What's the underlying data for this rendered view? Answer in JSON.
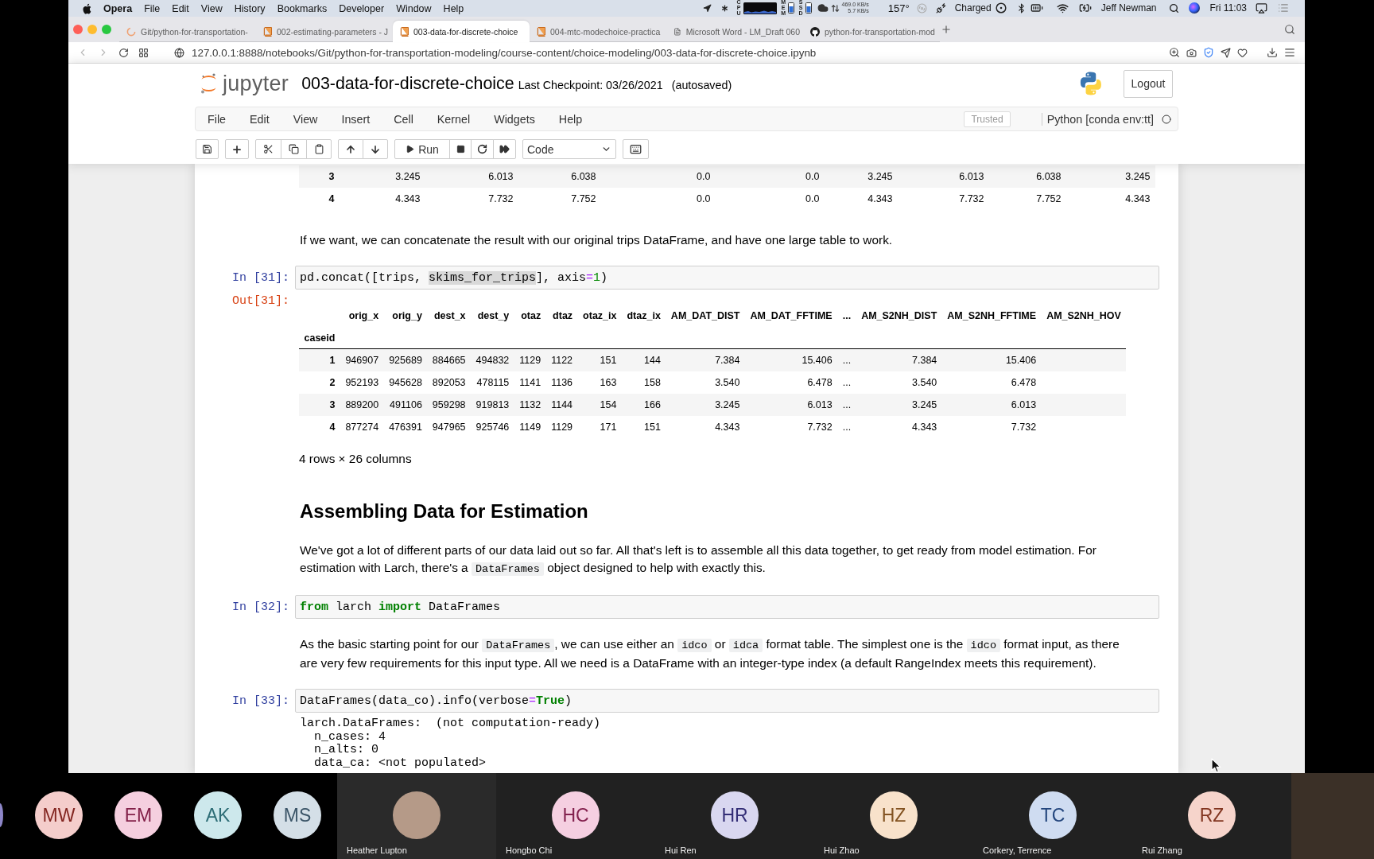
{
  "mac_menubar": {
    "app_name": "Opera",
    "menus": [
      "File",
      "Edit",
      "View",
      "History",
      "Bookmarks",
      "Developer",
      "Window",
      "Help"
    ],
    "cpu_label": "CPU",
    "memory_label": "MEM",
    "disk_label": "SSD",
    "network_up": "469.0 KB/s",
    "network_down": "5.7 KB/s",
    "temperature": "157°",
    "battery_status": "Charged",
    "user_name": "Jeff Newman",
    "clock": "Fri 11:03"
  },
  "browser": {
    "tabs": [
      {
        "kind": "loading",
        "title": "Git/python-for-transportation-",
        "selected": false
      },
      {
        "kind": "notebook",
        "title": "002-estimating-parameters - J",
        "selected": false
      },
      {
        "kind": "notebook",
        "title": "003-data-for-discrete-choice",
        "selected": true
      },
      {
        "kind": "notebook",
        "title": "004-mtc-modechoice-practica",
        "selected": false
      },
      {
        "kind": "document",
        "title": "Microsoft Word - LM_Draft 060",
        "selected": false
      },
      {
        "kind": "repo",
        "title": "python-for-transportation-mod",
        "selected": false
      }
    ],
    "url": "127.0.0.1:8888/notebooks/Git/python-for-transportation-modeling/course-content/choice-modeling/003-data-for-discrete-choice.ipynb"
  },
  "jupyter": {
    "logo_text": "jupyter",
    "notebook_name": "003-data-for-discrete-choice",
    "checkpoint": "Last Checkpoint: 03/26/2021",
    "autosave_status": "(autosaved)",
    "logout_label": "Logout",
    "menus": [
      "File",
      "Edit",
      "View",
      "Insert",
      "Cell",
      "Kernel",
      "Widgets",
      "Help"
    ],
    "trusted_label": "Trusted",
    "kernel_name": "Python [conda env:tt]",
    "run_label": "Run",
    "cell_type": "Code"
  },
  "notebook": {
    "cells": [
      {
        "kind": "table_fragment",
        "rows": [
          {
            "index": "3",
            "values": [
              "3.245",
              "6.013",
              "6.038",
              "0.0",
              "0.0",
              "3.245",
              "6.013",
              "6.038",
              "3.245"
            ]
          },
          {
            "index": "4",
            "values": [
              "4.343",
              "7.732",
              "7.752",
              "0.0",
              "0.0",
              "4.343",
              "7.732",
              "7.752",
              "4.343"
            ]
          }
        ]
      },
      {
        "kind": "markdown",
        "segments": [
          {
            "kind": "text",
            "text": "If we want, we can concatenate the result with our original trips DataFrame, and have one large table to work."
          }
        ]
      },
      {
        "kind": "code",
        "prompt": "In [31]:",
        "tokens": [
          {
            "kind": "plain",
            "text": "pd.concat([trips, "
          },
          {
            "kind": "highlight",
            "text": "skims_for_trips"
          },
          {
            "kind": "plain",
            "text": "], axis"
          },
          {
            "kind": "operator",
            "text": "="
          },
          {
            "kind": "number",
            "text": "1"
          },
          {
            "kind": "plain",
            "text": ")"
          }
        ],
        "output": {
          "kind": "dataframe",
          "prompt": "Out[31]:",
          "index_name": "caseid",
          "columns": [
            "orig_x",
            "orig_y",
            "dest_x",
            "dest_y",
            "otaz",
            "dtaz",
            "otaz_ix",
            "dtaz_ix",
            "AM_DAT_DIST",
            "AM_DAT_FFTIME",
            "...",
            "AM_S2NH_DIST",
            "AM_S2NH_FFTIME",
            "AM_S2NH_HOV"
          ],
          "rows": [
            {
              "index": "1",
              "values": [
                "946907",
                "925689",
                "884665",
                "494832",
                "1129",
                "1122",
                "151",
                "144",
                "7.384",
                "15.406",
                "...",
                "7.384",
                "15.406"
              ]
            },
            {
              "index": "2",
              "values": [
                "952193",
                "945628",
                "892053",
                "478115",
                "1141",
                "1136",
                "163",
                "158",
                "3.540",
                "6.478",
                "...",
                "3.540",
                "6.478"
              ]
            },
            {
              "index": "3",
              "values": [
                "889200",
                "491106",
                "959298",
                "919813",
                "1132",
                "1144",
                "154",
                "166",
                "3.245",
                "6.013",
                "...",
                "3.245",
                "6.013"
              ]
            },
            {
              "index": "4",
              "values": [
                "877274",
                "476391",
                "947965",
                "925746",
                "1149",
                "1129",
                "171",
                "151",
                "4.343",
                "7.732",
                "...",
                "4.343",
                "7.732"
              ]
            }
          ],
          "summary": "4 rows × 26 columns"
        }
      },
      {
        "kind": "heading",
        "text": "Assembling Data for Estimation"
      },
      {
        "kind": "markdown",
        "segments": [
          {
            "kind": "text",
            "text": "We've got a lot of different parts of our data laid out so far. All that's left is to assemble all this data together, to get ready from model estimation. For estimation with Larch, there's a "
          },
          {
            "kind": "code",
            "text": "DataFrames"
          },
          {
            "kind": "text",
            "text": " object designed to help with exactly this."
          }
        ]
      },
      {
        "kind": "code",
        "prompt": "In [32]:",
        "tokens": [
          {
            "kind": "keyword",
            "text": "from"
          },
          {
            "kind": "plain",
            "text": " larch "
          },
          {
            "kind": "keyword",
            "text": "import"
          },
          {
            "kind": "plain",
            "text": " DataFrames"
          }
        ]
      },
      {
        "kind": "markdown",
        "segments": [
          {
            "kind": "text",
            "text": "As the basic starting point for our "
          },
          {
            "kind": "code",
            "text": "DataFrames"
          },
          {
            "kind": "text",
            "text": ", we can use either an "
          },
          {
            "kind": "code",
            "text": "idco"
          },
          {
            "kind": "text",
            "text": " or "
          },
          {
            "kind": "code",
            "text": "idca"
          },
          {
            "kind": "text",
            "text": " format table. The simplest one is the "
          },
          {
            "kind": "code",
            "text": "idco"
          },
          {
            "kind": "text",
            "text": " format input, as there are very few requirements for this input type. All we need is a DataFrame with an integer-type index (a default RangeIndex meets this requirement)."
          }
        ]
      },
      {
        "kind": "code",
        "prompt": "In [33]:",
        "tokens": [
          {
            "kind": "plain",
            "text": "DataFrames(data_co).info(verbose"
          },
          {
            "kind": "operator",
            "text": "="
          },
          {
            "kind": "keyword",
            "text": "True"
          },
          {
            "kind": "plain",
            "text": ")"
          }
        ],
        "output": {
          "kind": "stream",
          "lines": [
            "larch.DataFrames:  (not computation-ready)",
            "  n_cases: 4",
            "  n_alts: 0",
            "  data_ca: <not populated>"
          ]
        }
      }
    ]
  },
  "meeting": {
    "gallery": [
      {
        "kind": "partial",
        "color": "#8d86c8"
      },
      {
        "kind": "initials",
        "initials": "MW",
        "color": "#f4cdcb"
      },
      {
        "kind": "initials",
        "initials": "EM",
        "color": "#f5cfdf"
      },
      {
        "kind": "initials",
        "initials": "AK",
        "color": "#cde8ec"
      },
      {
        "kind": "initials",
        "initials": "MS",
        "color": "#d4dfe7"
      }
    ],
    "tiles": [
      {
        "kind": "photo",
        "name": "Heather Lupton"
      },
      {
        "kind": "initials",
        "name": "Hongbo Chi",
        "initials": "HC",
        "color": "#f5cfe1"
      },
      {
        "kind": "initials",
        "name": "Hui Ren",
        "initials": "HR",
        "color": "#d9d7f0"
      },
      {
        "kind": "initials",
        "name": "Hui Zhao",
        "initials": "HZ",
        "color": "#f8e2cb"
      },
      {
        "kind": "initials",
        "name": "Corkery, Terrence",
        "initials": "TC",
        "color": "#cfdcf1"
      },
      {
        "kind": "initials",
        "name": "Rui Zhang",
        "initials": "RZ",
        "color": "#f6d4cb"
      }
    ]
  }
}
